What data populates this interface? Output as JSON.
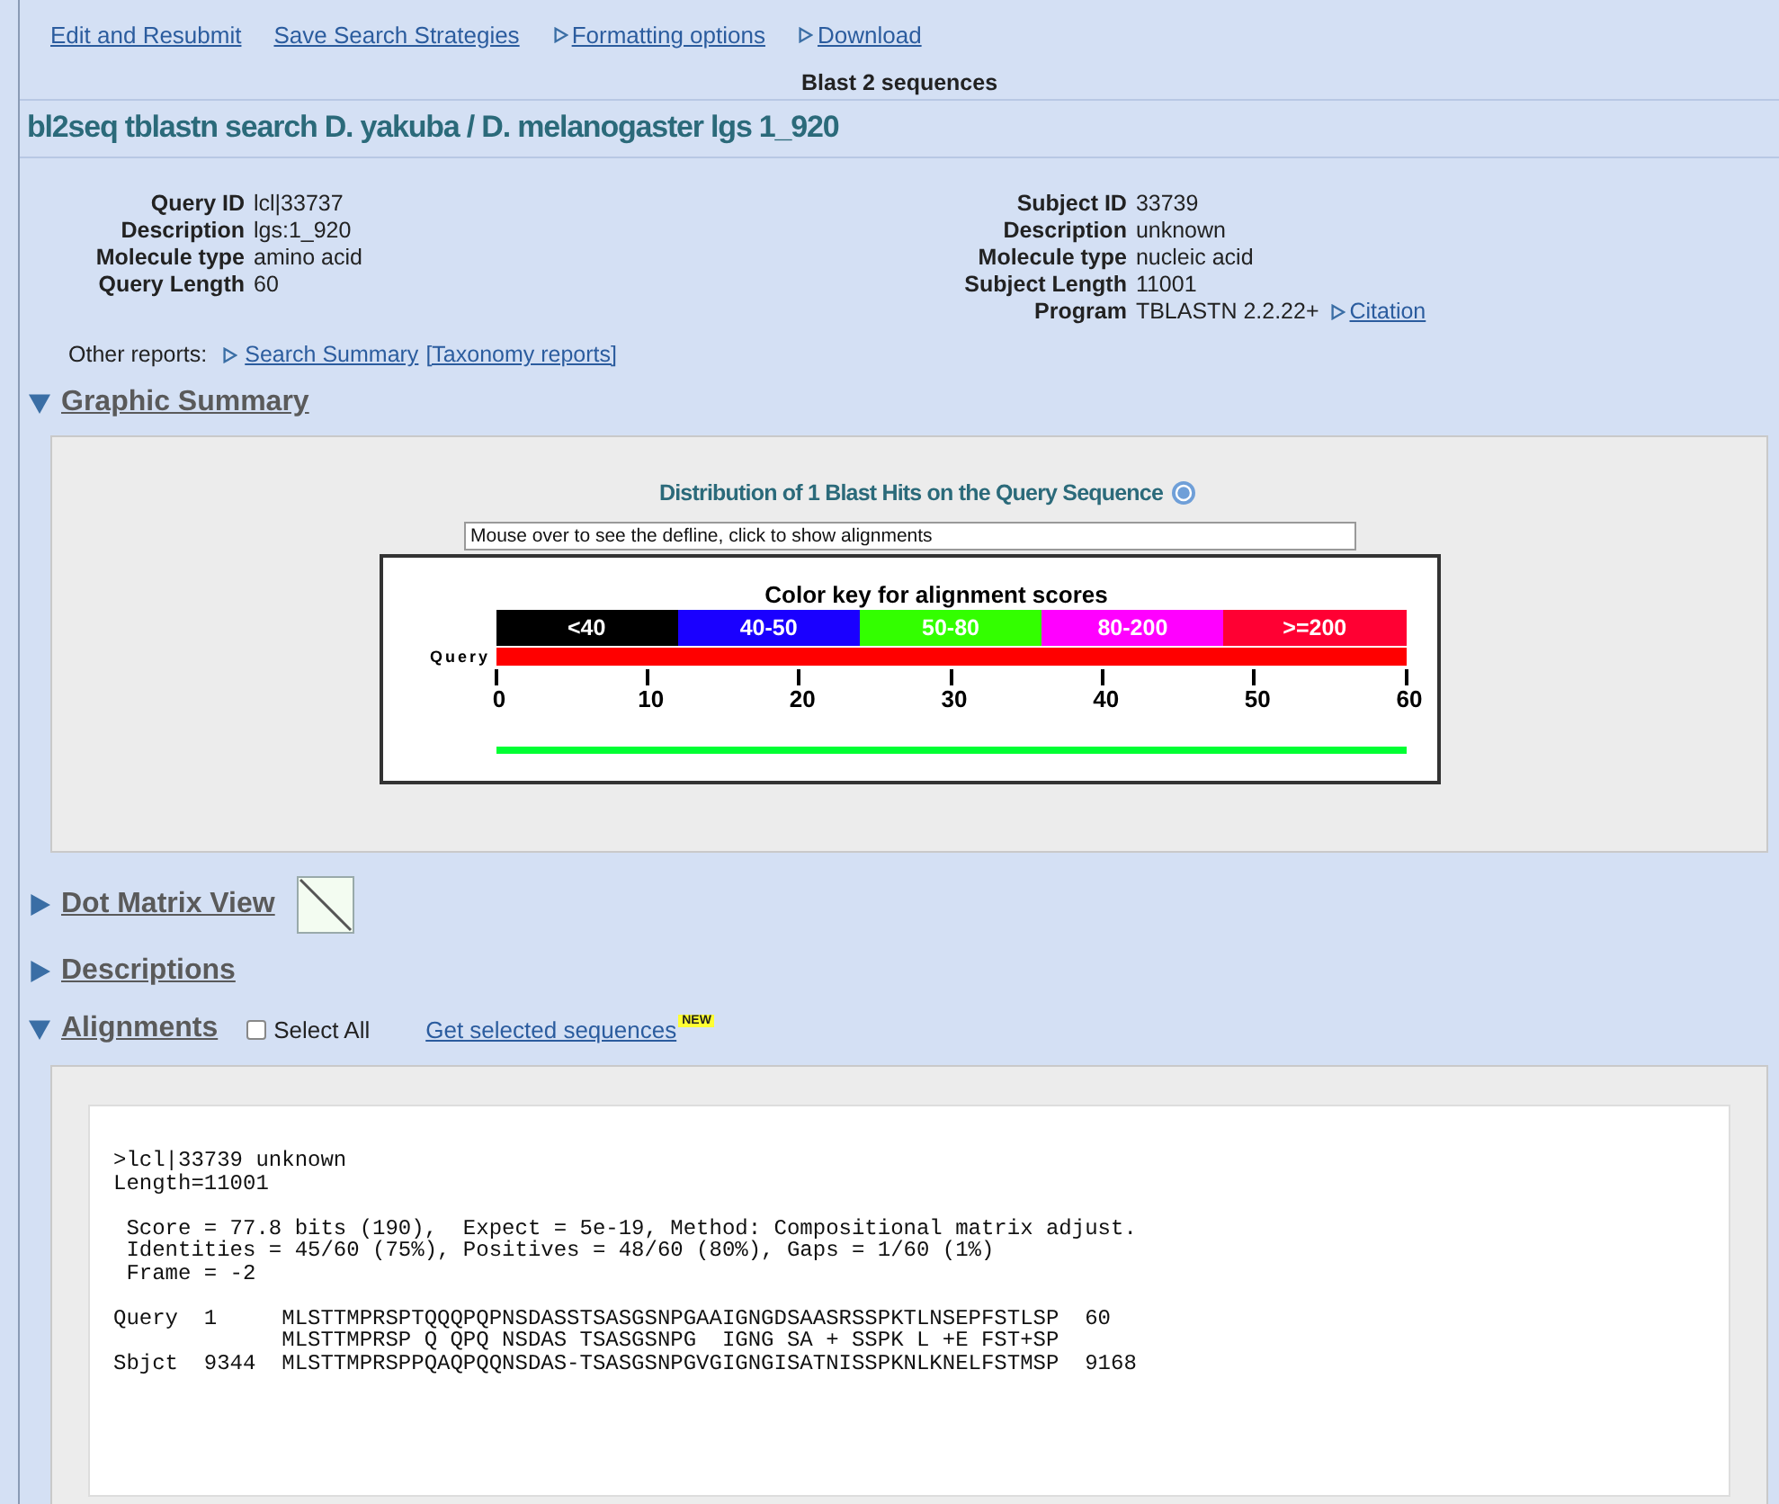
{
  "toolbar": [
    {
      "label": "Edit and Resubmit",
      "arrow": false
    },
    {
      "label": "Save Search Strategies",
      "arrow": false
    },
    {
      "label": "Formatting options",
      "arrow": true
    },
    {
      "label": "Download",
      "arrow": true
    }
  ],
  "program_title": "Blast 2 sequences",
  "search_title": "bl2seq tblastn search D. yakuba / D. melanogaster lgs 1_920",
  "query_info": [
    {
      "label": "Query ID",
      "value": "lcl|33737"
    },
    {
      "label": "Description",
      "value": "lgs:1_920"
    },
    {
      "label": "Molecule type",
      "value": "amino acid"
    },
    {
      "label": "Query Length",
      "value": "60"
    }
  ],
  "subject_info": [
    {
      "label": "Subject ID",
      "value": "33739"
    },
    {
      "label": "Description",
      "value": "unknown"
    },
    {
      "label": "Molecule type",
      "value": "nucleic acid"
    },
    {
      "label": "Subject Length",
      "value": "11001"
    },
    {
      "label": "Program",
      "value": "TBLASTN 2.2.22+",
      "link": "Citation"
    }
  ],
  "other_reports": {
    "label": "Other reports:",
    "links": [
      "Search Summary",
      "[Taxonomy reports]"
    ]
  },
  "graphic_summary": {
    "heading": "Graphic Summary",
    "expanded": true,
    "title": "Distribution of 1 Blast Hits on the Query Sequence",
    "defline_box": "Mouse over to see the defline, click to show alignments",
    "key_title": "Color key for alignment scores",
    "color_key": [
      {
        "label": "<40",
        "color": "#000000"
      },
      {
        "label": "40-50",
        "color": "#1a00ff"
      },
      {
        "label": "50-80",
        "color": "#33ff00"
      },
      {
        "label": "80-200",
        "color": "#ff00ff"
      },
      {
        "label": ">=200",
        "color": "#ff0033"
      }
    ],
    "query_label": "Query",
    "axis_ticks": [
      "0",
      "10",
      "20",
      "30",
      "40",
      "50",
      "60"
    ],
    "hits": [
      {
        "color": "#00ff33"
      }
    ]
  },
  "sections": [
    {
      "heading": "Dot Matrix View",
      "expanded": false,
      "kind": "dotmatrix"
    },
    {
      "heading": "Descriptions",
      "expanded": false,
      "kind": "plain"
    },
    {
      "heading": "Alignments",
      "expanded": true,
      "kind": "alignments",
      "select_all": {
        "label": "Select All",
        "checked": false
      },
      "link": "Get selected sequences",
      "badge": "NEW"
    }
  ],
  "alignment": {
    "blocks": [
      [
        ">lcl|33739 unknown",
        "Length=11001"
      ],
      [
        " Score = 77.8 bits (190),  Expect = 5e-19, Method: Compositional matrix adjust.",
        " Identities = 45/60 (75%), Positives = 48/60 (80%), Gaps = 1/60 (1%)",
        " Frame = -2"
      ],
      [
        "Query  1     MLSTTMPRSPTQQQPQPNSDASSTSASGSNPGAAIGNGDSAASRSSPKTLNSEPFSTLSP  60",
        "             MLSTTMPRSP Q QPQ NSDAS TSASGSNPG  IGNG SA + SSPK L +E FST+SP",
        "Sbjct  9344  MLSTTMPRSPPQAQPQQNSDAS-TSASGSNPGVGIGNGISATNISSPKNLKNELFSTMSP  9168"
      ]
    ]
  }
}
